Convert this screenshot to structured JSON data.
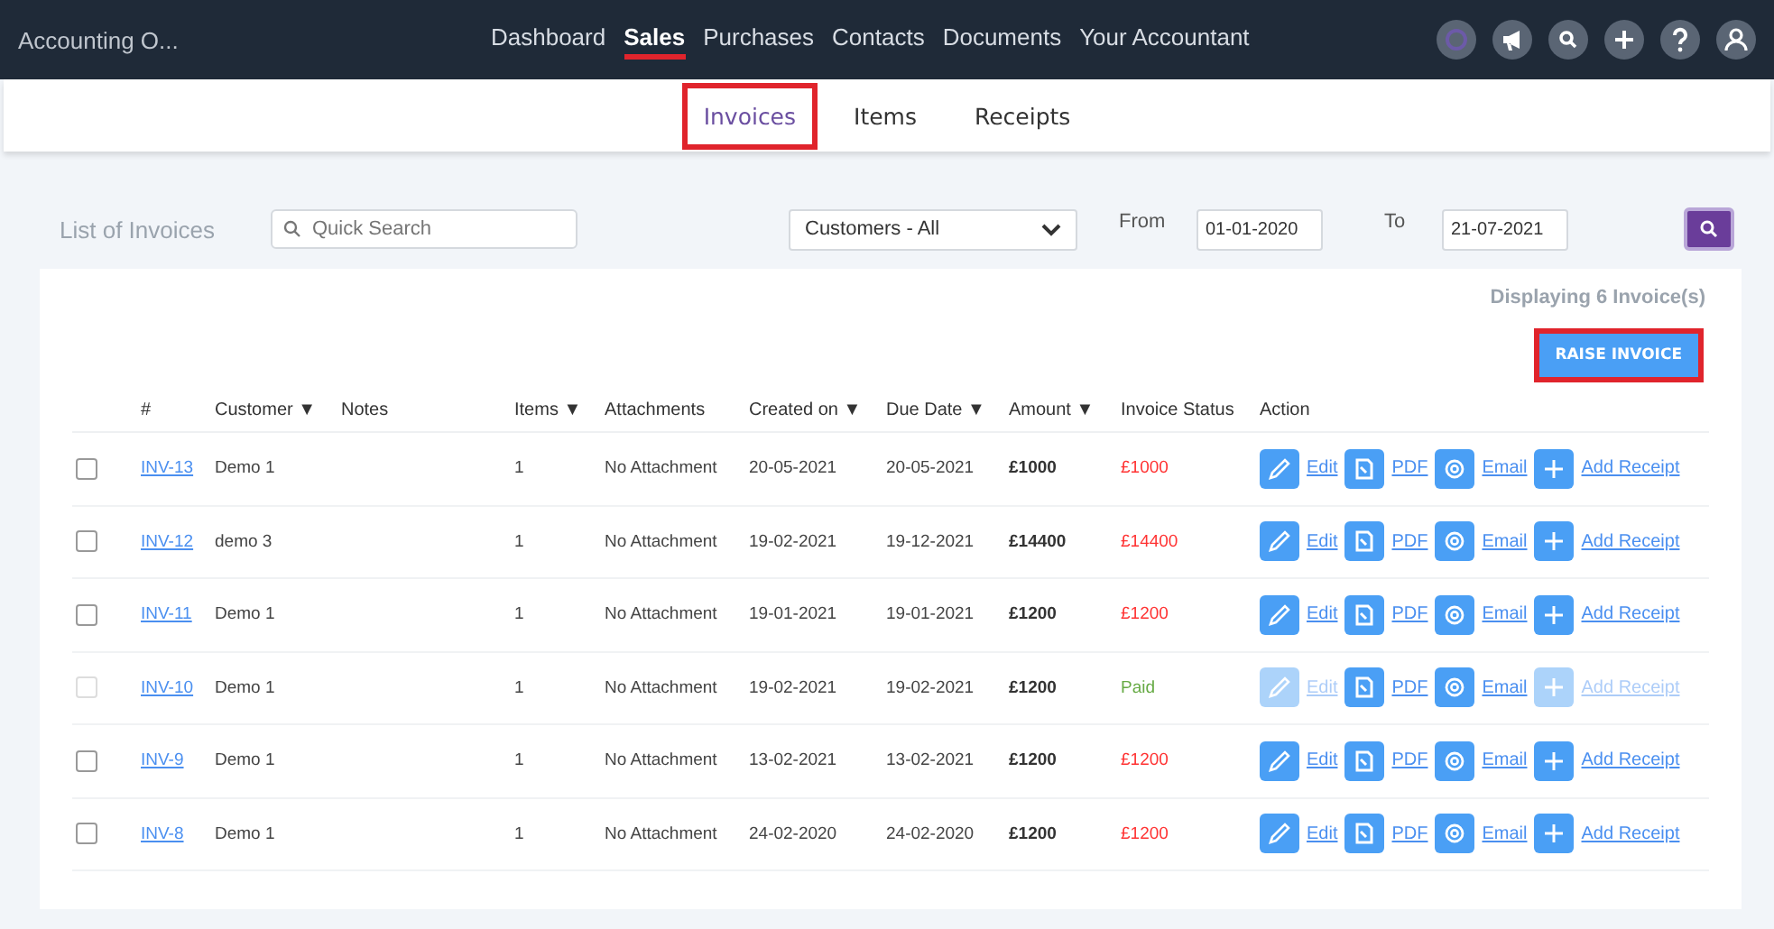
{
  "app": {
    "title": "Accounting O..."
  },
  "nav": [
    {
      "label": "Dashboard",
      "selected": false
    },
    {
      "label": "Sales",
      "selected": true
    },
    {
      "label": "Purchases",
      "selected": false
    },
    {
      "label": "Contacts",
      "selected": false
    },
    {
      "label": "Documents",
      "selected": false
    },
    {
      "label": "Your Accountant",
      "selected": false
    }
  ],
  "subnav": [
    {
      "label": "Invoices",
      "selected": true,
      "highlighted": true
    },
    {
      "label": "Items",
      "selected": false,
      "highlighted": false
    },
    {
      "label": "Receipts",
      "selected": false,
      "highlighted": false
    }
  ],
  "toolbar": {
    "title": "List of Invoices",
    "search": {
      "placeholder": "Quick Search"
    },
    "customer_filter": "Customers - All",
    "from_label": "From",
    "from": "01-01-2020",
    "to_label": "To",
    "to": "21-07-2021"
  },
  "summary": "Displaying 6 Invoice(s)",
  "raise_button": {
    "label": "RAISE INVOICE",
    "highlighted": true
  },
  "table": {
    "columns": [
      {
        "label": "#",
        "sortable": false
      },
      {
        "label": "Customer",
        "sortable": true
      },
      {
        "label": "Notes",
        "sortable": false
      },
      {
        "label": "Items",
        "sortable": true
      },
      {
        "label": "Attachments",
        "sortable": false
      },
      {
        "label": "Created on",
        "sortable": true
      },
      {
        "label": "Due Date",
        "sortable": true
      },
      {
        "label": "Amount",
        "sortable": true
      },
      {
        "label": "Invoice Status",
        "sortable": false
      },
      {
        "label": "Action",
        "sortable": false
      }
    ],
    "sort_marker": "▼",
    "rows": [
      {
        "number": "INV-13",
        "customer": "Demo 1",
        "items": "1",
        "attachments": "No Attachment",
        "created": "20-05-2021",
        "due": "20-05-2021",
        "amount": "£1000",
        "status": "£1000",
        "paid": false,
        "disabled": false,
        "actions": [
          {
            "kind": "edit",
            "label": "Edit",
            "disabled": false
          },
          {
            "kind": "pdf",
            "label": "PDF",
            "disabled": false
          },
          {
            "kind": "email",
            "label": "Email",
            "disabled": false
          },
          {
            "kind": "receipt",
            "label": "Add Receipt",
            "disabled": false
          }
        ]
      },
      {
        "number": "INV-12",
        "customer": "demo 3",
        "items": "1",
        "attachments": "No Attachment",
        "created": "19-02-2021",
        "due": "19-12-2021",
        "amount": "£14400",
        "status": "£14400",
        "paid": false,
        "disabled": false,
        "actions": [
          {
            "kind": "edit",
            "label": "Edit",
            "disabled": false
          },
          {
            "kind": "pdf",
            "label": "PDF",
            "disabled": false
          },
          {
            "kind": "email",
            "label": "Email",
            "disabled": false
          },
          {
            "kind": "receipt",
            "label": "Add Receipt",
            "disabled": false
          }
        ]
      },
      {
        "number": "INV-11",
        "customer": "Demo 1",
        "items": "1",
        "attachments": "No Attachment",
        "created": "19-01-2021",
        "due": "19-01-2021",
        "amount": "£1200",
        "status": "£1200",
        "paid": false,
        "disabled": false,
        "actions": [
          {
            "kind": "edit",
            "label": "Edit",
            "disabled": false
          },
          {
            "kind": "pdf",
            "label": "PDF",
            "disabled": false
          },
          {
            "kind": "email",
            "label": "Email",
            "disabled": false
          },
          {
            "kind": "receipt",
            "label": "Add Receipt",
            "disabled": false
          }
        ]
      },
      {
        "number": "INV-10",
        "customer": "Demo 1",
        "items": "1",
        "attachments": "No Attachment",
        "created": "19-02-2021",
        "due": "19-02-2021",
        "amount": "£1200",
        "status": "Paid",
        "paid": true,
        "disabled": true,
        "actions": [
          {
            "kind": "edit",
            "label": "Edit",
            "disabled": true
          },
          {
            "kind": "pdf",
            "label": "PDF",
            "disabled": false
          },
          {
            "kind": "email",
            "label": "Email",
            "disabled": false
          },
          {
            "kind": "receipt",
            "label": "Add Receipt",
            "disabled": true
          }
        ]
      },
      {
        "number": "INV-9",
        "customer": "Demo 1",
        "items": "1",
        "attachments": "No Attachment",
        "created": "13-02-2021",
        "due": "13-02-2021",
        "amount": "£1200",
        "status": "£1200",
        "paid": false,
        "disabled": false,
        "actions": [
          {
            "kind": "edit",
            "label": "Edit",
            "disabled": false
          },
          {
            "kind": "pdf",
            "label": "PDF",
            "disabled": false
          },
          {
            "kind": "email",
            "label": "Email",
            "disabled": false
          },
          {
            "kind": "receipt",
            "label": "Add Receipt",
            "disabled": false
          }
        ]
      },
      {
        "number": "INV-8",
        "customer": "Demo 1",
        "items": "1",
        "attachments": "No Attachment",
        "created": "24-02-2020",
        "due": "24-02-2020",
        "amount": "£1200",
        "status": "£1200",
        "paid": false,
        "disabled": false,
        "actions": [
          {
            "kind": "edit",
            "label": "Edit",
            "disabled": false
          },
          {
            "kind": "pdf",
            "label": "PDF",
            "disabled": false
          },
          {
            "kind": "email",
            "label": "Email",
            "disabled": false
          },
          {
            "kind": "receipt",
            "label": "Add Receipt",
            "disabled": false
          }
        ]
      }
    ]
  }
}
